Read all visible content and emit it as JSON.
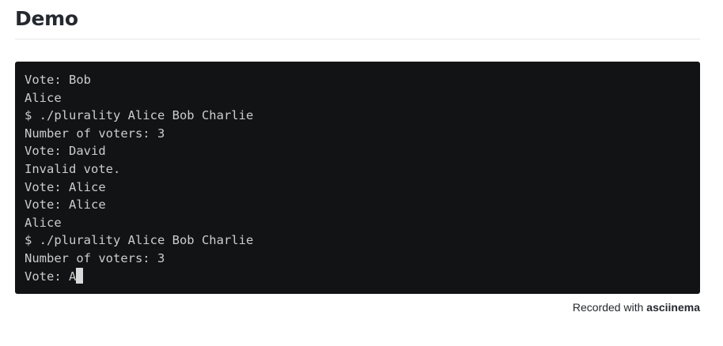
{
  "header": {
    "title": "Demo"
  },
  "terminal": {
    "lines": [
      "Vote: Bob",
      "Alice",
      "$ ./plurality Alice Bob Charlie",
      "Number of voters: 3",
      "Vote: David",
      "Invalid vote.",
      "Vote: Alice",
      "Vote: Alice",
      "Alice",
      "$ ./plurality Alice Bob Charlie",
      "Number of voters: 3",
      "Vote: A"
    ]
  },
  "footer": {
    "recorded_with": "Recorded with ",
    "link_text": "asciinema"
  },
  "colors": {
    "terminal_background": "#121314",
    "terminal_text": "#cccccc",
    "cursor": "#d9d9d9"
  }
}
